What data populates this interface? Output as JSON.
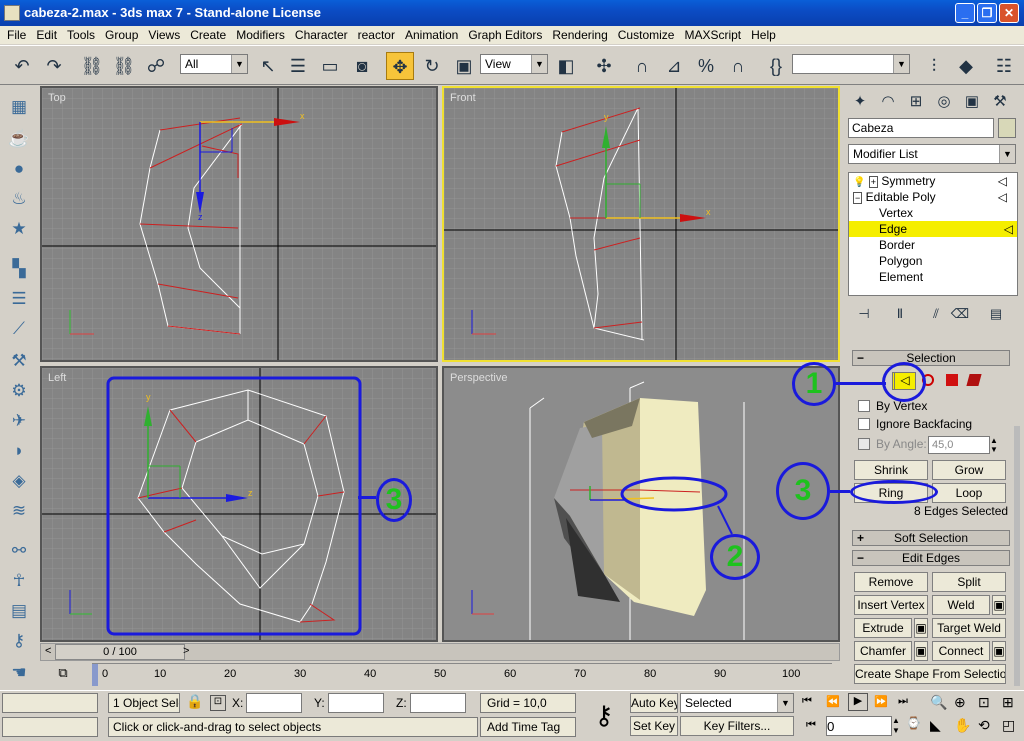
{
  "window": {
    "title": "cabeza-2.max - 3ds max 7 - Stand-alone License"
  },
  "menubar": [
    "File",
    "Edit",
    "Tools",
    "Group",
    "Views",
    "Create",
    "Modifiers",
    "Character",
    "reactor",
    "Animation",
    "Graph Editors",
    "Rendering",
    "Customize",
    "MAXScript",
    "Help"
  ],
  "toolbar": {
    "filter_value": "All",
    "refcoord_value": "View"
  },
  "viewports": {
    "top": "Top",
    "front": "Front",
    "left": "Left",
    "perspective": "Perspective"
  },
  "axes": {
    "x": "x",
    "y": "y",
    "z": "z"
  },
  "command_panel": {
    "object_name": "Cabeza",
    "object_color": "#d8d8b8",
    "modifier_list": "Modifier List",
    "stack": [
      {
        "label": "Symmetry",
        "indent": 0
      },
      {
        "label": "Editable Poly",
        "indent": 0
      },
      {
        "label": "Vertex",
        "indent": 1
      },
      {
        "label": "Edge",
        "indent": 1,
        "selected": true
      },
      {
        "label": "Border",
        "indent": 1
      },
      {
        "label": "Polygon",
        "indent": 1
      },
      {
        "label": "Element",
        "indent": 1
      }
    ],
    "selection": {
      "header": "Selection",
      "by_vertex": "By Vertex",
      "ignore_backfacing": "Ignore Backfacing",
      "by_angle": "By Angle:",
      "angle_value": "45,0",
      "shrink": "Shrink",
      "grow": "Grow",
      "ring": "Ring",
      "loop": "Loop",
      "status": "8 Edges Selected"
    },
    "soft_selection": "Soft Selection",
    "edit_edges": {
      "header": "Edit Edges",
      "remove": "Remove",
      "split": "Split",
      "insert_vertex": "Insert Vertex",
      "weld": "Weld",
      "extrude": "Extrude",
      "target_weld": "Target Weld",
      "chamfer": "Chamfer",
      "connect": "Connect",
      "create_shape": "Create Shape From Selection"
    }
  },
  "timeline": {
    "frame": "0 / 100",
    "ticks": [
      "0",
      "10",
      "20",
      "30",
      "40",
      "50",
      "60",
      "70",
      "80",
      "90",
      "100"
    ]
  },
  "status": {
    "selected": "1 Object Sele",
    "x_label": "X:",
    "y_label": "Y:",
    "z_label": "Z:",
    "grid": "Grid = 10,0",
    "prompt": "Click or click-and-drag to select objects",
    "add_time_tag": "Add Time Tag",
    "auto_key": "Auto Key",
    "set_key": "Set Key",
    "key_mode": "Selected",
    "key_filters": "Key Filters...",
    "frame_value": "0"
  },
  "annotations": [
    "1",
    "2",
    "3",
    "3"
  ],
  "colors": {
    "accent_yellow": "#f0e030",
    "annotation_blue": "#1a1adc",
    "annotation_green": "#1ec21e",
    "selected_edge": "#cc2020"
  }
}
